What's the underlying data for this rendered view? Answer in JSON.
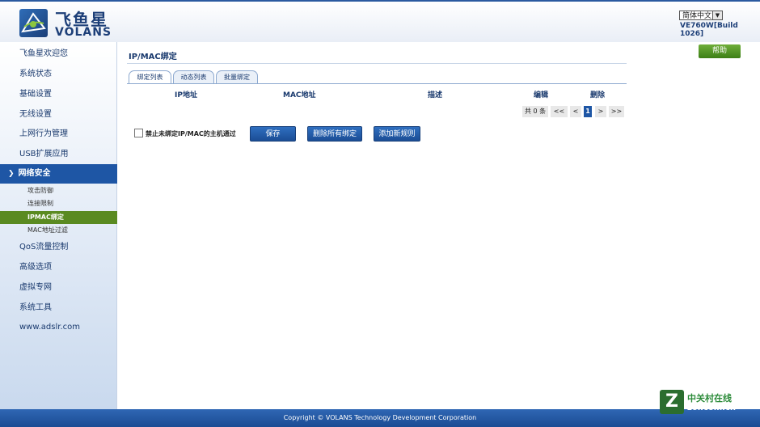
{
  "header": {
    "logo_cn": "飞鱼星",
    "logo_en": "VOLANS",
    "language": "简体中文",
    "version": "VE760W[Build 1026]"
  },
  "sidebar": {
    "items": [
      {
        "label": "飞鱼星欢迎您"
      },
      {
        "label": "系统状态"
      },
      {
        "label": "基础设置"
      },
      {
        "label": "无线设置"
      },
      {
        "label": "上网行为管理"
      },
      {
        "label": "USB扩展应用"
      },
      {
        "label": "网络安全",
        "active": true
      },
      {
        "label": "QoS流量控制"
      },
      {
        "label": "高级选项"
      },
      {
        "label": "虚拟专网"
      },
      {
        "label": "系统工具"
      },
      {
        "label": "www.adslr.com"
      }
    ],
    "subitems": [
      {
        "label": "攻击防御"
      },
      {
        "label": "连接限制"
      },
      {
        "label": "IPMAC绑定",
        "active": true
      },
      {
        "label": "MAC地址过滤"
      }
    ]
  },
  "main": {
    "help": "帮助",
    "title": "IP/MAC绑定",
    "tabs": [
      {
        "label": "绑定列表",
        "active": true
      },
      {
        "label": "动态列表"
      },
      {
        "label": "批量绑定"
      }
    ],
    "columns": [
      "IP地址",
      "MAC地址",
      "描述",
      "编辑",
      "删除"
    ],
    "pager": {
      "count": "共 0 条",
      "first": "<<",
      "prev": "<",
      "current": "1",
      "next": ">",
      "last": ">>"
    },
    "checkbox_label": "禁止未绑定IP/MAC的主机通过",
    "buttons": {
      "save": "保存",
      "delete_all": "删除所有绑定",
      "add_rule": "添加新规则"
    }
  },
  "footer": {
    "copyright": "Copyright © VOLANS Technology Development Corporation"
  },
  "watermark": {
    "z": "Z",
    "cn": "中关村在线",
    "en": "zol.com.cn"
  },
  "colors": {
    "brand_blue": "#1e56a5",
    "active_green": "#5a8a21",
    "help_green": "#4f9a26"
  }
}
